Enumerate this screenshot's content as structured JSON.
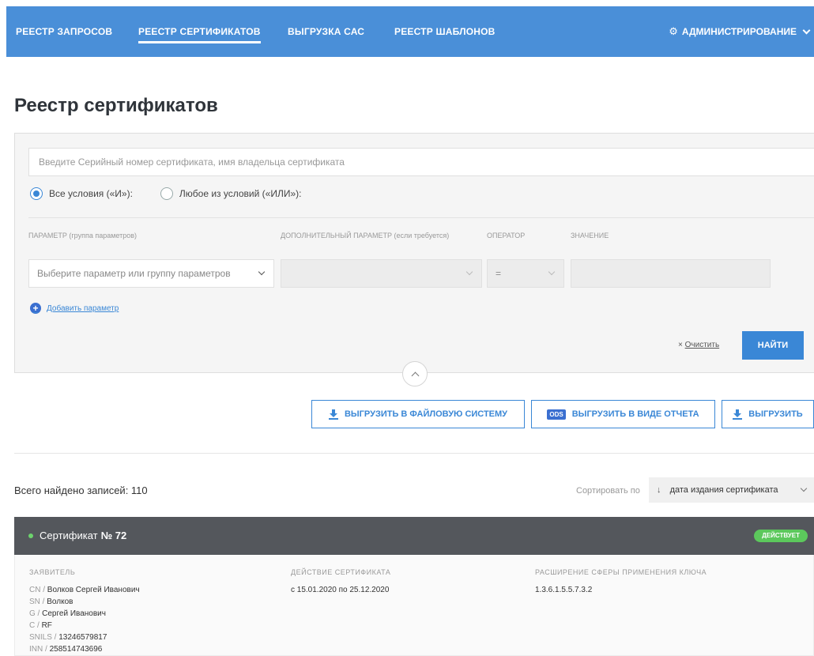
{
  "nav": {
    "items": [
      {
        "label": "РЕЕСТР ЗАПРОСОВ"
      },
      {
        "label": "РЕЕСТР СЕРТИФИКАТОВ"
      },
      {
        "label": "ВЫГРУЗКА САС"
      },
      {
        "label": "РЕЕСТР ШАБЛОНОВ"
      }
    ],
    "active_index": 1,
    "admin_label": "АДМИНИСТРИРОВАНИЕ"
  },
  "page_title": "Реестр сертификатов",
  "filter": {
    "search_placeholder": "Введите Серийный номер сертификата, имя владельца сертификата",
    "radio_all": "Все условия («И»):",
    "radio_any": "Любое из условий («ИЛИ»):",
    "selected_radio": "all",
    "headers": {
      "param_main": "ПАРАМЕТР",
      "param_tail": "(группа параметров)",
      "extra_main": "ДОПОЛНИТЕЛЬНЫЙ ПАРАМЕТР",
      "extra_tail": "(если требуется)",
      "operator": "ОПЕРАТОР",
      "value": "ЗНАЧЕНИЕ"
    },
    "param_placeholder": "Выберите параметр или группу параметров",
    "operator_value": "=",
    "add_param": "Добавить параметр",
    "clear_label": "Очистить",
    "find_label": "НАЙТИ"
  },
  "export": {
    "fs_label": "ВЫГРУЗИТЬ В ФАЙЛОВУЮ СИСТЕМУ",
    "ods_badge": "ODS",
    "report_label": "ВЫГРУЗИТЬ В ВИДЕ ОТЧЕТА",
    "export_label": "ВЫГРУЗИТЬ"
  },
  "results": {
    "total": "Всего найдено записей: 110",
    "sort_label": "Сортировать по",
    "sort_value": "дата издания сертификата"
  },
  "certificate": {
    "title_prefix": "Сертификат",
    "number": "№ 72",
    "status": "ДЕЙСТВУЕТ",
    "status_color": "#5cc85c",
    "applicant_header": "ЗАЯВИТЕЛЬ",
    "fields": [
      {
        "k": "CN",
        "v": "Волков Сергей Иванович"
      },
      {
        "k": "SN",
        "v": "Волков"
      },
      {
        "k": "G",
        "v": "Сергей Иванович"
      },
      {
        "k": "C",
        "v": "RF"
      },
      {
        "k": "SNILS",
        "v": "13246579817"
      },
      {
        "k": "INN",
        "v": "258514743696"
      }
    ],
    "validity_header": "ДЕЙСТВИЕ СЕРТИФИКАТА",
    "validity": "с 15.01.2020 по 25.12.2020",
    "ext_header": "РАСШИРЕНИЕ СФЕРЫ ПРИМЕНЕНИЯ КЛЮЧА",
    "ext_value": "1.3.6.1.5.5.7.3.2"
  },
  "colors": {
    "nav_bg": "#4a8fd8",
    "accent": "#3a87d6",
    "card_header_bg": "#54575c"
  }
}
